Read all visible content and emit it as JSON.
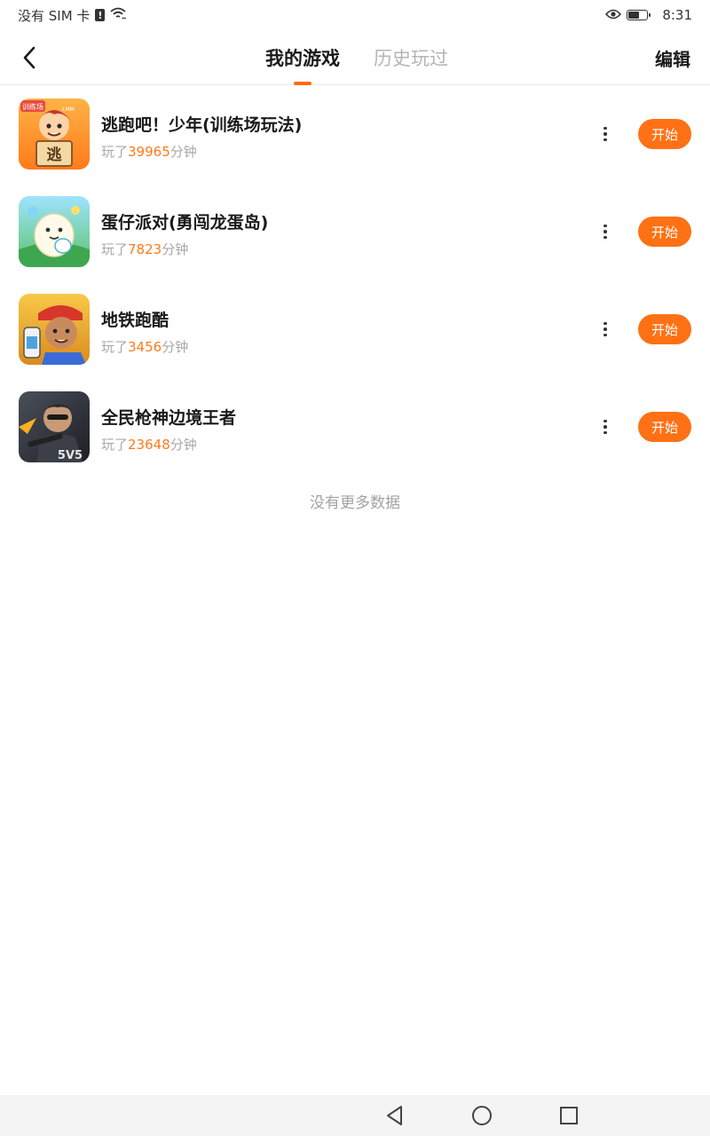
{
  "status_bar": {
    "carrier": "没有 SIM 卡",
    "sim_alert": "!",
    "time": "8:31",
    "icons": [
      "sim-alert-icon",
      "wifi-icon",
      "eye-icon",
      "battery-icon"
    ]
  },
  "header": {
    "back_icon": "chevron-left-icon",
    "tabs": [
      {
        "label": "我的游戏",
        "active": true
      },
      {
        "label": "历史玩过",
        "active": false
      }
    ],
    "edit_label": "编辑"
  },
  "games": [
    {
      "name": "逃跑吧！少年(训练场玩法)",
      "played_prefix": "玩了",
      "minutes": "39965",
      "unit": "分钟",
      "start_label": "开始",
      "icon_badge": "训练场",
      "icon_sign": "逃",
      "icon_tag": "LMM"
    },
    {
      "name": "蛋仔派对(勇闯龙蛋岛)",
      "played_prefix": "玩了",
      "minutes": "7823",
      "unit": "分钟",
      "start_label": "开始"
    },
    {
      "name": "地铁跑酷",
      "played_prefix": "玩了",
      "minutes": "3456",
      "unit": "分钟",
      "start_label": "开始"
    },
    {
      "name": "全民枪神边境王者",
      "played_prefix": "玩了",
      "minutes": "23648",
      "unit": "分钟",
      "start_label": "开始",
      "icon_tag": "5V5"
    }
  ],
  "no_more_text": "没有更多数据",
  "nav_bar": {
    "icons": [
      "back-triangle-icon",
      "home-circle-icon",
      "recents-square-icon"
    ]
  },
  "colors": {
    "accent": "#ff7114",
    "minutes": "#ff7a1a"
  }
}
